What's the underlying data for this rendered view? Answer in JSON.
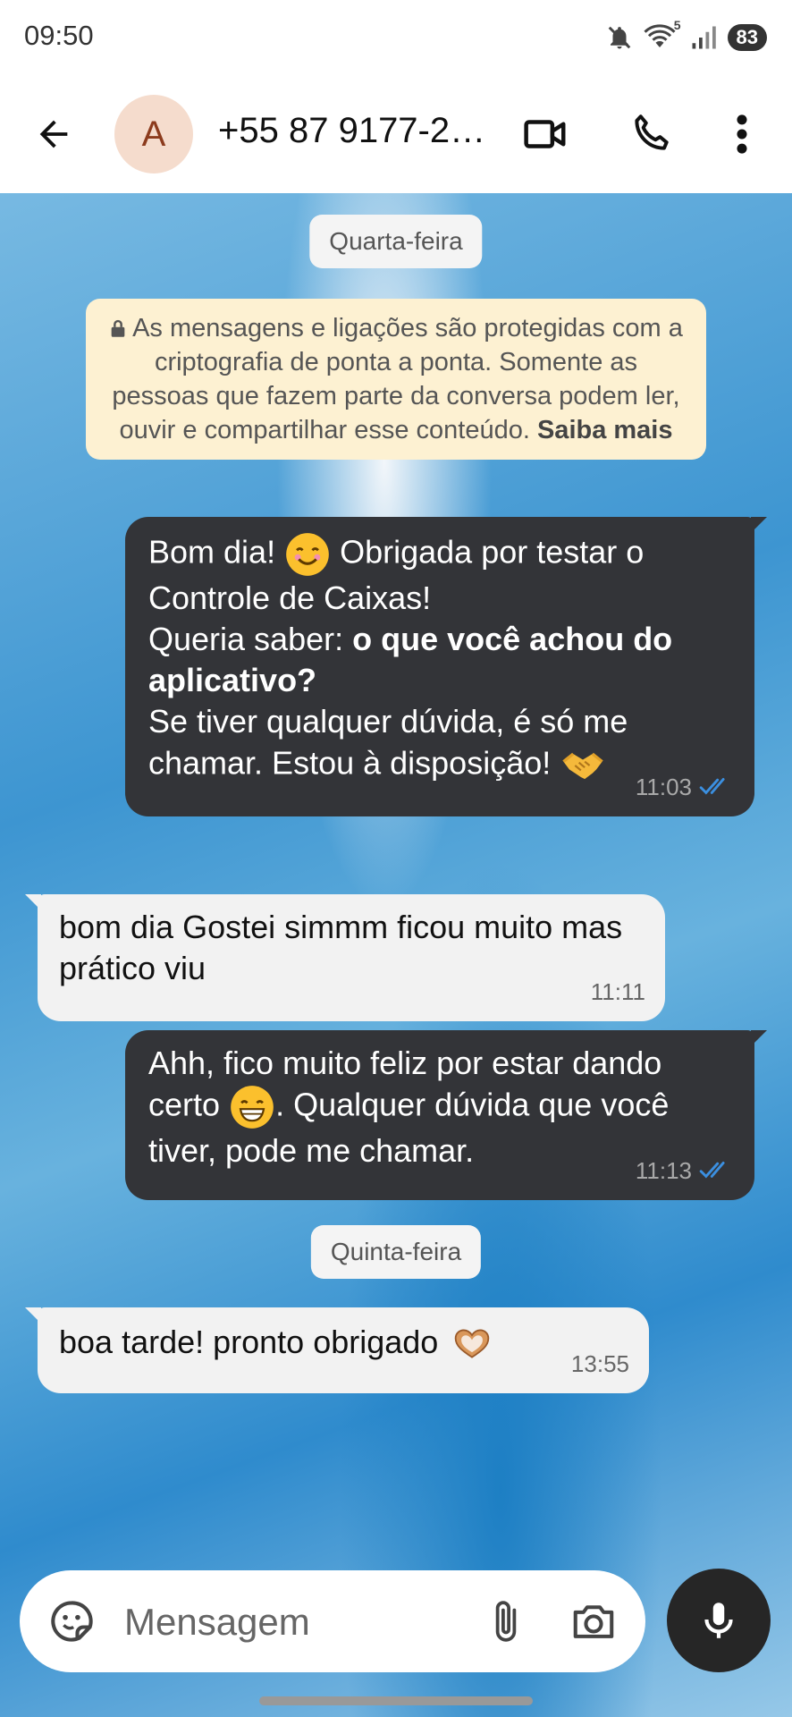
{
  "status_bar": {
    "time": "09:50",
    "battery": "83",
    "wifi_badge": "5"
  },
  "header": {
    "avatar_letter": "A",
    "contact_name": "+55 87 9177-2…"
  },
  "chat": {
    "date_1": "Quarta-feira",
    "encryption_notice": "As mensagens e ligações são protegidas com a criptografia de ponta a ponta. Somente as pessoas que fazem parte da conversa podem ler, ouvir e compartilhar esse conteúdo.",
    "encryption_link": "Saiba mais",
    "msg1": {
      "part1": "Bom dia!",
      "part2": "Obrigada por testar o Controle de Caixas!",
      "part3": "Queria saber:",
      "part3_bold": "o que você achou do aplicativo?",
      "part4": "Se tiver qualquer dúvida, é só me chamar. Estou à disposição!",
      "time": "11:03"
    },
    "msg2": {
      "text": "bom dia Gostei simmm ficou muito mas prático viu",
      "time": "11:11"
    },
    "msg3": {
      "part1": "Ahh, fico muito feliz por estar dando certo",
      "part2": ". Qualquer dúvida que você tiver, pode me chamar.",
      "time": "11:13"
    },
    "date_2": "Quinta-feira",
    "msg4": {
      "text": "boa tarde! pronto obrigado",
      "time": "13:55"
    }
  },
  "composer": {
    "placeholder": "Mensagem"
  },
  "colors": {
    "outgoing_bubble": "#333438",
    "incoming_bubble": "#f2f2f2",
    "read_ticks": "#3b8fe0",
    "notice_bg": "#fdf1d2"
  }
}
